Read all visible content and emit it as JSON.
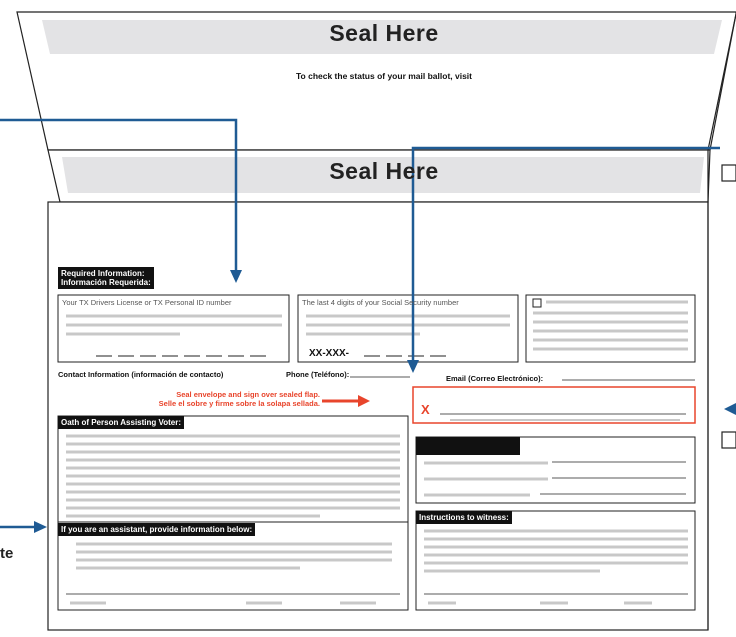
{
  "flap_top": {
    "seal_label": "Seal Here",
    "status_text": "To check the status of your mail ballot, visit"
  },
  "flap_inner": {
    "seal_label": "Seal Here"
  },
  "required_info": {
    "header_line1": "Required Information:",
    "header_line2": "Información Requerida:"
  },
  "id_box": {
    "title": "Your TX Drivers License or TX Personal ID number"
  },
  "ssn_box": {
    "title": "The last 4 digits of your Social Security number",
    "prefix": "XX-XXX-"
  },
  "contact": {
    "contact_label": "Contact Information (información de contacto)",
    "phone_label": "Phone (Teléfono):",
    "email_label": "Email (Correo Electrónico):"
  },
  "instruction": {
    "line1": "Seal envelope and sign over sealed flap.",
    "line2": "Selle el sobre y firme sobre la solapa sellada."
  },
  "signature": {
    "mark": "X"
  },
  "oath": {
    "header": "Oath of Person Assisting Voter:"
  },
  "assistant": {
    "header": "If you are an assistant, provide information below:"
  },
  "witness": {
    "header": "Instructions to witness:"
  },
  "left_callout": {
    "fragment": "te"
  },
  "colors": {
    "callout_arrow": "#1f5b94",
    "accent_red": "#e8452c",
    "seal_band": "#e3e3e5",
    "placeholder_line": "#c8c8c8"
  }
}
